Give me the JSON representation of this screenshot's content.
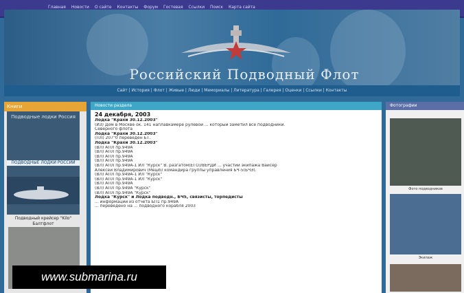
{
  "top_nav": {
    "items": [
      "Главная",
      "Новости",
      "О сайте",
      "Контакты",
      "Форум",
      "Гостевая",
      "Ссылки",
      "Поиск",
      "Карта сайта"
    ]
  },
  "banner": {
    "title": "Российский Подводный Флот"
  },
  "main_nav": {
    "text": "Сайт | История | Флот | Живые | Люди | Мемориалы | Литература | Галерея | Оценки | Ссылки | Контакты"
  },
  "left": {
    "header": "Книги",
    "book_title": "Подводные лодки Россия",
    "book_subtitle": "ПОДВОДНЫЕ ЛОДКИ РОССИИ",
    "caption": "Подводный крейсер \"Kilo\" Балтфлот"
  },
  "center": {
    "header": "Новости раздела",
    "date": "24 декабря, 2003",
    "title1": "Лодка \"Крахи 30.12.2003\"",
    "lines": [
      "(ИЗ) Дом в Москве ок. 141 наплавкамере рулевой ... который заметил все подводники.",
      "Северного флота",
      "(ПЛ) 207\"0 переведен БТ.",
      "(ВЛ) АПЛ пр.949А",
      "(ВЛ) АПЛ пр.949А",
      "(ВЛ) АПЛ пр.949А",
      "(ВЛ) АПЛ пр.949А",
      "(ВЛ) АПЛ пр.949А-1 ИЛ \"Курск\" В. разгатом(ЕГО)/ВЕРДИ ... участии экипажа Вайсер",
      "Алексей Владимирович (Мешб) командира группы управления БЧ-5(БЧЭ).",
      "(ВЛ) АПЛ пр.949А-1 ИЛ \"Курск\"",
      "(ВЛ) АПЛ пр.949А-1 ИЛ \"Курск\"",
      "(ВЛ) АПЛ пр.949А",
      "(ВЛ) АПЛ пр.949А \"Курск\"",
      "(ВЛ) АПЛ пр.949А \"Курск\"",
      "Лодка \"Курск\" и Лодка подводн., БЧ5, связисты, торпедисты",
      "... информации из отчета БП1 пр.949А",
      "... переведено на ... подводного корабля 2003"
    ],
    "title2": "Лодка \"Крахи 30.12.2003\"",
    "title3": "Лодка \"Крахи 30.12.2003\""
  },
  "right": {
    "header": "Фотографии",
    "caption1": "Фото подводников",
    "caption2": "Экипаж"
  },
  "watermark": {
    "text": "www.submarina.ru"
  },
  "colors": {
    "banner": "#2f6a98",
    "accent_left": "#e6a534",
    "accent_center": "#3ea7c7"
  }
}
